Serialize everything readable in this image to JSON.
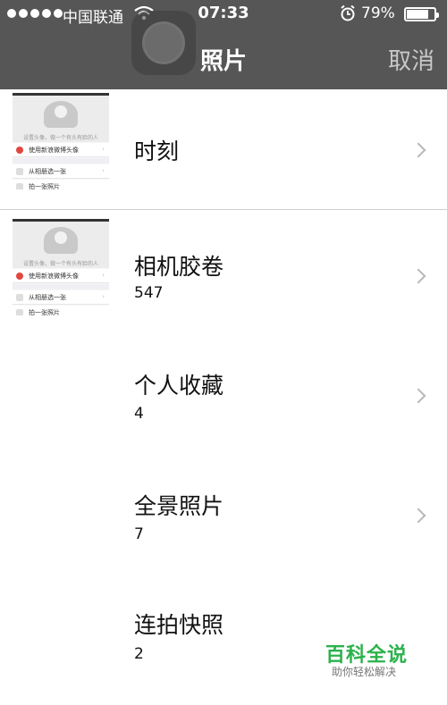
{
  "status_bar": {
    "carrier": "中国联通",
    "time": "07:33",
    "battery": "79%",
    "battery_level": 0.79,
    "icons": [
      "signal-icon",
      "wifi-icon",
      "alarm-icon",
      "battery-icon"
    ]
  },
  "nav": {
    "title": "照片",
    "cancel_label": "取消"
  },
  "albums": [
    {
      "label": "时刻",
      "count": ""
    },
    {
      "label": "相机胶卷",
      "count": "547"
    },
    {
      "label": "个人收藏",
      "count": "4"
    },
    {
      "label": "全景照片",
      "count": "7"
    },
    {
      "label": "连拍快照",
      "count": "2"
    }
  ],
  "thumbnail": {
    "caption": "设置头像，做一个有头有脸的人",
    "items": [
      "使用新浪微博头像",
      "从相册选一张",
      "拍一张照片"
    ]
  },
  "watermark": {
    "title": "百科全说",
    "subtitle": "助你轻松解决"
  },
  "colors": {
    "nav_background": "#565656",
    "watermark_green": "#2bb24c"
  }
}
